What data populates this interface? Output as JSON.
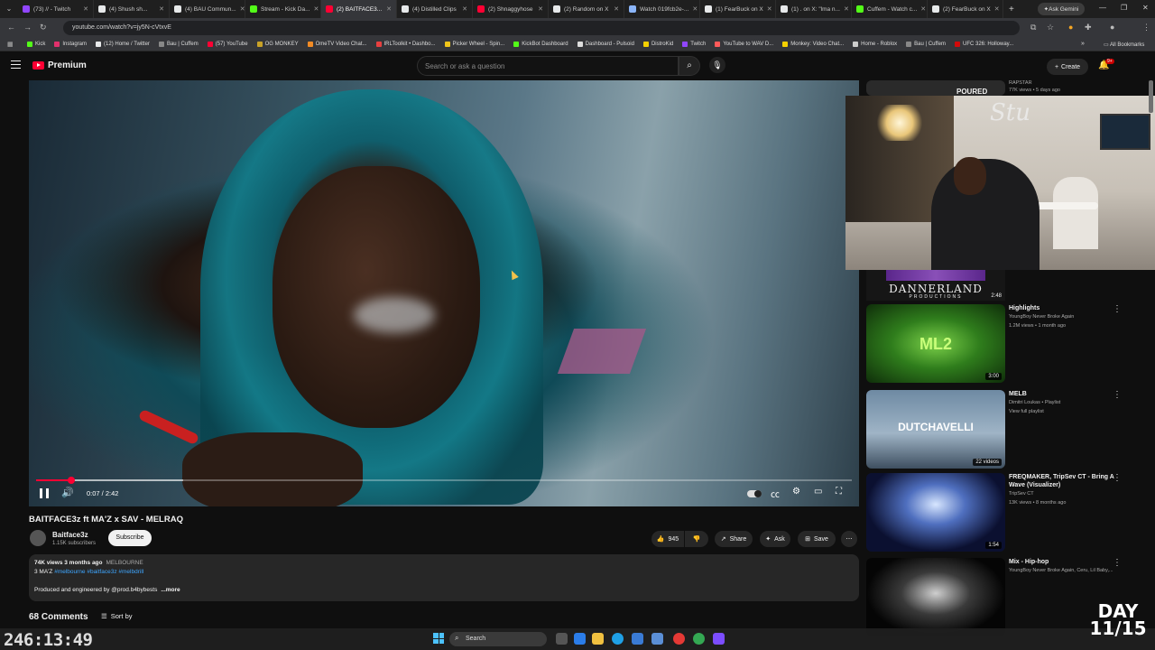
{
  "browser": {
    "tabs": [
      {
        "label": "(73) // - Twitch",
        "color": "#9146ff"
      },
      {
        "label": "(4) Shush sh...",
        "color": "#e7e9ea"
      },
      {
        "label": "(4) BAU Commun...",
        "color": "#e7e9ea"
      },
      {
        "label": "Stream - Kick Da...",
        "color": "#53fc18"
      },
      {
        "label": "(2) BAITFACE3...",
        "color": "#ff0033",
        "active": true
      },
      {
        "label": "(4) Distilled Clips",
        "color": "#e7e9ea"
      },
      {
        "label": "(2) Shnaggyhose",
        "color": "#ff0033"
      },
      {
        "label": "(2) Random on X",
        "color": "#e7e9ea"
      },
      {
        "label": "Watch 019fcb2e-...",
        "color": "#8ab4f8"
      },
      {
        "label": "(1) FearBuck on X",
        "color": "#e7e9ea"
      },
      {
        "label": "(1) . on X: \"lma n...",
        "color": "#e7e9ea"
      },
      {
        "label": "Cuffem - Watch c...",
        "color": "#53fc18"
      },
      {
        "label": "(2) FearBuck on X",
        "color": "#e7e9ea"
      }
    ],
    "new_tab": "+",
    "ask_gemini": "Ask Gemini",
    "url": "youtube.com/watch?v=jy5N-cVtxvE",
    "bookmarks": [
      {
        "label": "Kick",
        "color": "#53fc18"
      },
      {
        "label": "Instagram",
        "color": "#e1306c"
      },
      {
        "label": "(12) Home / Twitter",
        "color": "#e7e9ea"
      },
      {
        "label": "Bau | Cuffem",
        "color": "#888888"
      },
      {
        "label": "(57) YouTube",
        "color": "#ff0033"
      },
      {
        "label": "OG MONKEY",
        "color": "#c9a227"
      },
      {
        "label": "OmeTV Video Chat...",
        "color": "#f28b25"
      },
      {
        "label": "IRLToolkit • Dashbo...",
        "color": "#e84040"
      },
      {
        "label": "Picker Wheel - Spin...",
        "color": "#f0c419"
      },
      {
        "label": "KickBot Dashboard",
        "color": "#53fc18"
      },
      {
        "label": "Dashboard - Pulsoid",
        "color": "#dddddd"
      },
      {
        "label": "DistroKid",
        "color": "#f5d000"
      },
      {
        "label": "Twitch",
        "color": "#9146ff"
      },
      {
        "label": "YouTube to WAV D...",
        "color": "#ff5a5a"
      },
      {
        "label": "Monkey: Video Chat...",
        "color": "#f5d000"
      },
      {
        "label": "Home - Roblox",
        "color": "#cccccc"
      },
      {
        "label": "Bau | Cuffem",
        "color": "#888888"
      },
      {
        "label": "UFC 326: Holloway...",
        "color": "#d20a0a"
      }
    ],
    "bookmarks_more": "»",
    "all_bookmarks": "All Bookmarks"
  },
  "youtube": {
    "logo_text": "Premium",
    "search_placeholder": "Search or ask a question",
    "create_label": "Create",
    "notif_count": "9+"
  },
  "player": {
    "current_time": "0:07",
    "duration": "2:42",
    "time_display": "0:07 / 2:42",
    "progress_fraction": 0.043,
    "buffer_fraction": 0.18
  },
  "video": {
    "title": "BAITFACE3z ft MA'Z x SAV - MELRAQ",
    "channel": "Baitface3z",
    "subscribers": "1.15K subscribers",
    "subscribe_label": "Subscribe",
    "likes": "945",
    "share_label": "Share",
    "ask_label": "Ask",
    "save_label": "Save",
    "views_line": "74K views  3 months ago",
    "location": "MELBOURNE",
    "desc_line1_prefix": "3 MA'Z ",
    "desc_hashtags": "#melbourne #baitface3z #melbdrill",
    "desc_line2": "Produced and engineered by @prod.b4bybests",
    "more_label": "...more",
    "comment_count": "68 Comments",
    "sort_label": "Sort by"
  },
  "sidebar": {
    "top_item": {
      "channel": "RAPSTAR",
      "meta": "77K views • 5 days ago",
      "thumb_text": "POURED"
    },
    "dannerland": {
      "title": "DANNERLAND",
      "sub": "PRODUCTIONS",
      "duration": "2:48"
    },
    "items": [
      {
        "title": "Highlights",
        "channel": "YoungBoy Never Broke Again",
        "meta": "1.2M views • 1 month ago",
        "duration": "3:00",
        "thumb_text": "ML2"
      },
      {
        "title": "MELB",
        "channel": "Dimitri Loukas • Playlist",
        "meta": "View full playlist",
        "duration": "22 videos",
        "thumb_text": "DUTCHAVELLI"
      },
      {
        "title": "FREQMAKER, TripSev CT - Bring A Wave (Visualizer)",
        "channel": "TripSev CT",
        "meta": "13K views • 8 months ago",
        "duration": "1:54",
        "thumb_text": ""
      },
      {
        "title": "Mix - Hip-hop",
        "channel": "YoungBoy Never Broke Again, Ceru, Lil Baby,...",
        "meta": "",
        "duration": "",
        "thumb_text": ""
      }
    ]
  },
  "overlay": {
    "clock": "246:13:49",
    "day_line1": "DAY",
    "day_line2": "11/15",
    "webcam_sign": "Stu"
  },
  "taskbar": {
    "search_label": "Search"
  }
}
